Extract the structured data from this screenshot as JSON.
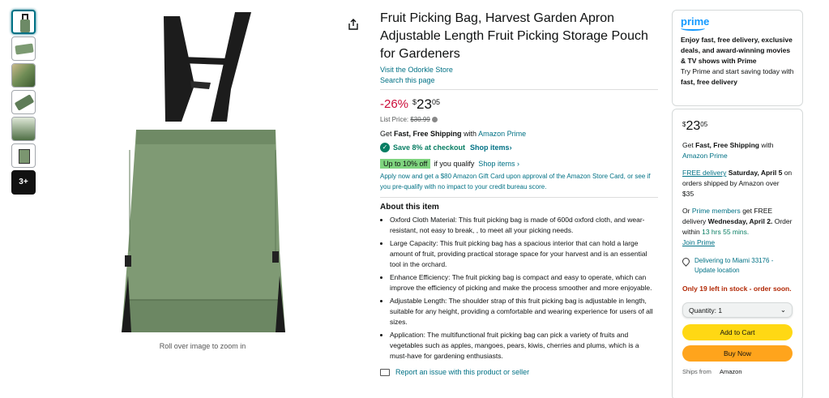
{
  "thumbnails": {
    "more_label": "3+"
  },
  "image": {
    "zoom_hint": "Roll over image to zoom in"
  },
  "product": {
    "title": "Fruit Picking Bag, Harvest Garden Apron Adjustable Length Fruit Picking Storage Pouch for Gardeners",
    "store_link": "Visit the Odorkle Store",
    "search_link": "Search this page",
    "discount": "-26%",
    "price_symbol": "$",
    "price_whole": "23",
    "price_fraction": "05",
    "list_price_label": "List Price:",
    "list_price_value": "$30.99",
    "shipping_prefix": "Get",
    "shipping_bold": "Fast, Free Shipping",
    "shipping_with": "with",
    "shipping_link": "Amazon Prime",
    "save_text": "Save 8% at checkout",
    "shop_items_bold": "Shop items",
    "upto_badge": "Up to 10% off",
    "qualify_text": "if you qualify",
    "shop_items": "Shop items",
    "card_offer": "Apply now and get a $80 Amazon Gift Card upon approval of the Amazon Store Card, or see if you pre-qualify with no impact to your credit bureau score.",
    "about_title": "About this item",
    "bullets": [
      "Oxford Cloth Material: This fruit picking bag is made of 600d oxford cloth, and wear-resistant, not easy to break, , to meet all your picking needs.",
      "Large Capacity: This fruit picking bag has a spacious interior that can hold a large amount of fruit, providing practical storage space for your harvest and is an essential tool in the orchard.",
      "Enhance Efficiency: The fruit picking bag is compact and easy to operate, which can improve the efficiency of picking and make the process smoother and more enjoyable.",
      "Adjustable Length: The shoulder strap of this fruit picking bag is adjustable in length, suitable for any height, providing a comfortable and wearing experience for users of all sizes.",
      "Application: The multifunctional fruit picking bag can pick a variety of fruits and vegetables such as apples, mangoes, pears, kiwis, cherries and plums, which is a must-have for gardening enthusiasts."
    ],
    "report_link": "Report an issue with this product or seller"
  },
  "prime": {
    "logo": "prime",
    "desc": "Enjoy fast, free delivery, exclusive deals, and award-winning movies & TV shows with Prime",
    "trial_prefix": "Try Prime and start saving today with",
    "trial_bold": "fast, free delivery"
  },
  "buybox": {
    "price_symbol": "$",
    "price_whole": "23",
    "price_fraction": "05",
    "ship_prefix": "Get",
    "ship_bold": "Fast, Free Shipping",
    "ship_with": "with",
    "ship_link": "Amazon Prime",
    "free_delivery_link": "FREE delivery",
    "delivery_date": "Saturday, April 5",
    "delivery_rest": "on orders shipped by Amazon over $35",
    "or_text": "Or",
    "prime_members_link": "Prime members",
    "get_free": "get FREE delivery",
    "fast_date": "Wednesday, April 2.",
    "order_within": "Order within",
    "countdown": "13 hrs 55 mins.",
    "join_prime": "Join Prime",
    "location": "Delivering to Miami 33176 - Update location",
    "stock": "Only 19 left in stock - order soon.",
    "quantity": "Quantity: 1",
    "add_to_cart": "Add to Cart",
    "buy_now": "Buy Now",
    "ships_from_label": "Ships from",
    "ships_from_value": "Amazon"
  }
}
